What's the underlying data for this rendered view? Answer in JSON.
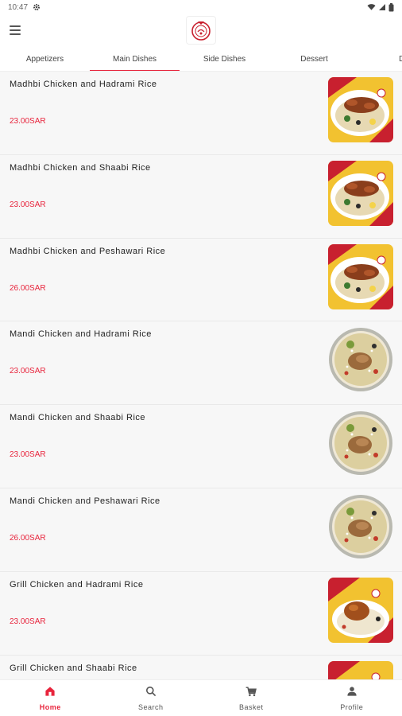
{
  "status_bar": {
    "time": "10:47"
  },
  "tabs": [
    {
      "label": "Appetizers"
    },
    {
      "label": "Main Dishes",
      "active": true
    },
    {
      "label": "Side Dishes"
    },
    {
      "label": "Dessert"
    },
    {
      "label": "Dri"
    }
  ],
  "items": [
    {
      "name": "Madhbi Chicken and Hadrami Rice",
      "price": "23.00SAR",
      "image": "madhbi"
    },
    {
      "name": "Madhbi Chicken and Shaabi Rice",
      "price": "23.00SAR",
      "image": "madhbi"
    },
    {
      "name": "Madhbi Chicken and Peshawari Rice",
      "price": "26.00SAR",
      "image": "madhbi"
    },
    {
      "name": "Mandi Chicken and Hadrami Rice",
      "price": "23.00SAR",
      "image": "mandi"
    },
    {
      "name": "Mandi Chicken and Shaabi Rice",
      "price": "23.00SAR",
      "image": "mandi"
    },
    {
      "name": "Mandi Chicken and Peshawari Rice",
      "price": "26.00SAR",
      "image": "mandi"
    },
    {
      "name": "Grill Chicken and Hadrami Rice",
      "price": "23.00SAR",
      "image": "grill"
    },
    {
      "name": "Grill Chicken and Shaabi Rice",
      "price": "",
      "image": "grill"
    }
  ],
  "bottom_nav": [
    {
      "label": "Home",
      "icon": "home-icon",
      "active": true
    },
    {
      "label": "Search",
      "icon": "search-icon"
    },
    {
      "label": "Basket",
      "icon": "cart-icon"
    },
    {
      "label": "Profile",
      "icon": "profile-icon"
    }
  ],
  "colors": {
    "accent": "#e8243c",
    "background": "#f7f7f7"
  }
}
